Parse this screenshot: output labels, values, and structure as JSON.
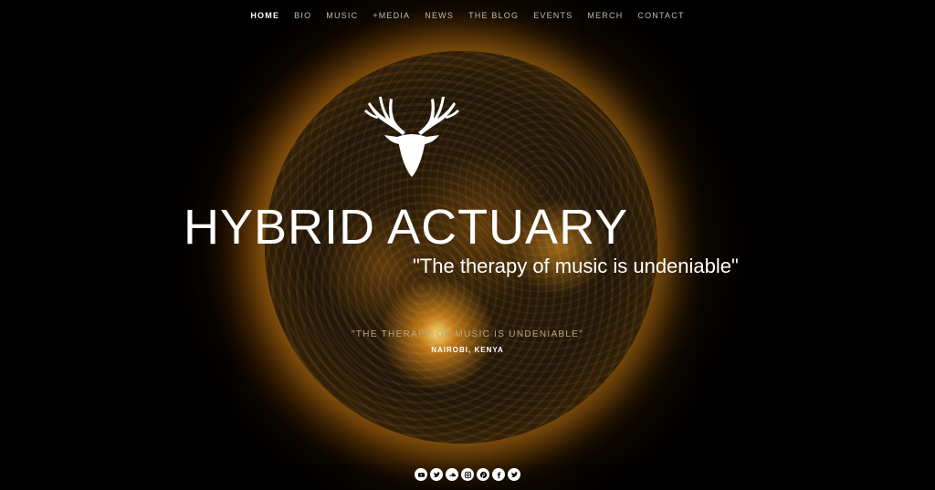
{
  "nav": {
    "items": [
      {
        "label": "HOME",
        "active": true
      },
      {
        "label": "BIO"
      },
      {
        "label": "MUSIC"
      },
      {
        "label": "+MEDIA"
      },
      {
        "label": "NEWS"
      },
      {
        "label": "THE BLOG"
      },
      {
        "label": "EVENTS"
      },
      {
        "label": "MERCH"
      },
      {
        "label": "CONTACT"
      }
    ]
  },
  "hero": {
    "title": "HYBRID ACTUARY",
    "tagline": "\"The therapy of music is undeniable\"",
    "sub_tagline": "\"THE THERAPY OF MUSIC IS UNDENIABLE\"",
    "location": "NAIROBI, KENYA",
    "logo_icon": "deer-antlers-icon"
  },
  "social": {
    "icons": [
      "youtube-icon",
      "twitter-icon",
      "soundcloud-icon",
      "instagram-icon",
      "pinterest-icon",
      "facebook-icon",
      "twitter-icon"
    ]
  },
  "colors": {
    "background": "#000000",
    "sun_glow": "#f2a51c",
    "nav_text": "#bdbdbd",
    "nav_active": "#ffffff"
  }
}
